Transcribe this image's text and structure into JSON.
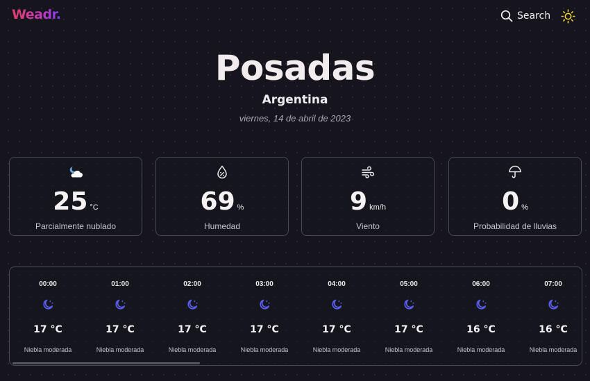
{
  "header": {
    "logo": "Weadr.",
    "search_label": "Search",
    "search_icon": "search-icon",
    "theme_icon": "sun-icon"
  },
  "location": {
    "city": "Posadas",
    "country": "Argentina",
    "date": "viernes, 14 de abril de 2023"
  },
  "stats": [
    {
      "icon": "partly-cloudy-night-icon",
      "value": "25",
      "unit": "°C",
      "label": "Parcialmente nublado"
    },
    {
      "icon": "humidity-icon",
      "value": "69",
      "unit": "%",
      "label": "Humedad"
    },
    {
      "icon": "wind-icon",
      "value": "9",
      "unit": "km/h",
      "label": "Viento"
    },
    {
      "icon": "umbrella-icon",
      "value": "0",
      "unit": "%",
      "label": "Probabilidad de lluvias"
    }
  ],
  "hourly": [
    {
      "time": "00:00",
      "icon": "moon-stars-icon",
      "temp": "17 °C",
      "desc": "Niebla moderada"
    },
    {
      "time": "01:00",
      "icon": "moon-stars-icon",
      "temp": "17 °C",
      "desc": "Niebla moderada"
    },
    {
      "time": "02:00",
      "icon": "moon-stars-icon",
      "temp": "17 °C",
      "desc": "Niebla moderada"
    },
    {
      "time": "03:00",
      "icon": "moon-stars-icon",
      "temp": "17 °C",
      "desc": "Niebla moderada"
    },
    {
      "time": "04:00",
      "icon": "moon-stars-icon",
      "temp": "17 °C",
      "desc": "Niebla moderada"
    },
    {
      "time": "05:00",
      "icon": "moon-stars-icon",
      "temp": "17 °C",
      "desc": "Niebla moderada"
    },
    {
      "time": "06:00",
      "icon": "moon-stars-icon",
      "temp": "16 °C",
      "desc": "Niebla moderada"
    },
    {
      "time": "07:00",
      "icon": "moon-stars-icon",
      "temp": "16 °C",
      "desc": "Niebla moderada"
    }
  ],
  "colors": {
    "background": "#16151d",
    "card_border": "#4a4954",
    "accent_moon": "#5b5bf0",
    "sun_icon": "#f2d23c",
    "logo_gradient_start": "#e23d6c",
    "logo_gradient_end": "#7c3cf0"
  }
}
